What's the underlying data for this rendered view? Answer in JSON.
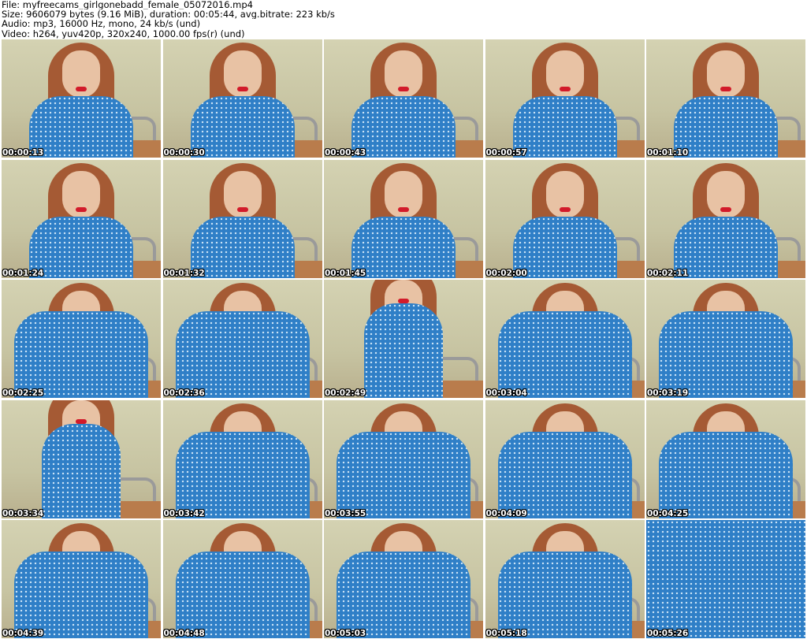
{
  "header": {
    "file_line": "File: myfreecams_girlgonebadd_female_05072016.mp4",
    "size_line": "Size: 9606079 bytes (9.16 MiB), duration: 00:05:44, avg.bitrate: 223 kb/s",
    "audio_line": "Audio: mp3, 16000 Hz, mono, 24 kb/s (und)",
    "video_line": "Video: h264, yuv420p, 320x240, 1000.00 fps(r) (und)"
  },
  "thumbnails": [
    {
      "timestamp": "00:00:13",
      "variant": "seated"
    },
    {
      "timestamp": "00:00:30",
      "variant": "seated"
    },
    {
      "timestamp": "00:00:43",
      "variant": "seated"
    },
    {
      "timestamp": "00:00:57",
      "variant": "seated"
    },
    {
      "timestamp": "00:01:10",
      "variant": "seated"
    },
    {
      "timestamp": "00:01:24",
      "variant": "seated"
    },
    {
      "timestamp": "00:01:32",
      "variant": "seated"
    },
    {
      "timestamp": "00:01:45",
      "variant": "seated"
    },
    {
      "timestamp": "00:02:00",
      "variant": "seated"
    },
    {
      "timestamp": "00:02:11",
      "variant": "seated"
    },
    {
      "timestamp": "00:02:25",
      "variant": "close"
    },
    {
      "timestamp": "00:02:36",
      "variant": "close"
    },
    {
      "timestamp": "00:02:49",
      "variant": "standing"
    },
    {
      "timestamp": "00:03:04",
      "variant": "close"
    },
    {
      "timestamp": "00:03:19",
      "variant": "close"
    },
    {
      "timestamp": "00:03:34",
      "variant": "standing"
    },
    {
      "timestamp": "00:03:42",
      "variant": "close"
    },
    {
      "timestamp": "00:03:55",
      "variant": "close"
    },
    {
      "timestamp": "00:04:09",
      "variant": "close"
    },
    {
      "timestamp": "00:04:25",
      "variant": "close"
    },
    {
      "timestamp": "00:04:39",
      "variant": "close"
    },
    {
      "timestamp": "00:04:48",
      "variant": "close"
    },
    {
      "timestamp": "00:05:03",
      "variant": "close"
    },
    {
      "timestamp": "00:05:18",
      "variant": "close"
    },
    {
      "timestamp": "00:05:26",
      "variant": "full"
    }
  ],
  "colors": {
    "dress": "#2f7fc7",
    "hair": "#a55a34",
    "lips": "#d21a2a",
    "wall": "#c9c7a6"
  }
}
